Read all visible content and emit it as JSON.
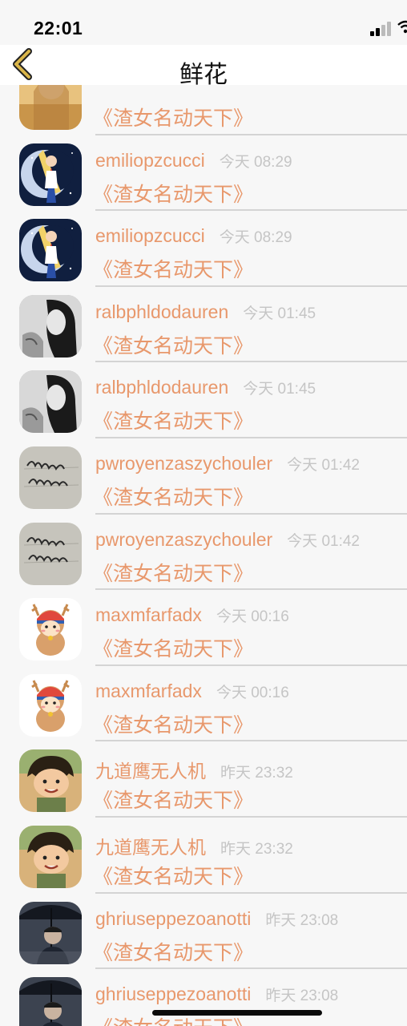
{
  "status_bar": {
    "time": "22:01"
  },
  "header": {
    "title": "鲜花",
    "back_icon": "chevron-left-icon"
  },
  "colors": {
    "accent": "#e8986c",
    "timestamp": "#c5c5c5",
    "divider": "#d4d4d4",
    "background": "#f7f7f7"
  },
  "list": {
    "items": [
      {
        "username": "",
        "time": "",
        "gift": "《渣女名动天下》",
        "avatar": "avatar-woman-portrait"
      },
      {
        "username": "emiliopzcucci",
        "time": "今天 08:29",
        "gift": "《渣女名动天下》",
        "avatar": "avatar-anime-moon"
      },
      {
        "username": "emiliopzcucci",
        "time": "今天 08:29",
        "gift": "《渣女名动天下》",
        "avatar": "avatar-anime-moon"
      },
      {
        "username": "ralbphldodauren",
        "time": "今天 01:45",
        "gift": "《渣女名动天下》",
        "avatar": "avatar-bw-woman"
      },
      {
        "username": "ralbphldodauren",
        "time": "今天 01:45",
        "gift": "《渣女名动天下》",
        "avatar": "avatar-bw-woman"
      },
      {
        "username": "pwroyenzaszychouler",
        "time": "今天 01:42",
        "gift": "《渣女名动天下》",
        "avatar": "avatar-handwriting"
      },
      {
        "username": "pwroyenzaszychouler",
        "time": "今天 01:42",
        "gift": "《渣女名动天下》",
        "avatar": "avatar-handwriting"
      },
      {
        "username": "maxmfarfadx",
        "time": "今天 00:16",
        "gift": "《渣女名动天下》",
        "avatar": "avatar-cartoon-deer"
      },
      {
        "username": "maxmfarfadx",
        "time": "今天 00:16",
        "gift": "《渣女名动天下》",
        "avatar": "avatar-cartoon-deer"
      },
      {
        "username": "九道鹰无人机",
        "time": "昨天 23:32",
        "gift": "《渣女名动天下》",
        "avatar": "avatar-cartoon-boy"
      },
      {
        "username": "九道鹰无人机",
        "time": "昨天 23:32",
        "gift": "《渣女名动天下》",
        "avatar": "avatar-cartoon-boy"
      },
      {
        "username": "ghriuseppezoanotti",
        "time": "昨天 23:08",
        "gift": "《渣女名动天下》",
        "avatar": "avatar-man-umbrella"
      },
      {
        "username": "ghriuseppezoanotti",
        "time": "昨天 23:08",
        "gift": "《渣女名动天下》",
        "avatar": "avatar-man-umbrella"
      }
    ]
  }
}
